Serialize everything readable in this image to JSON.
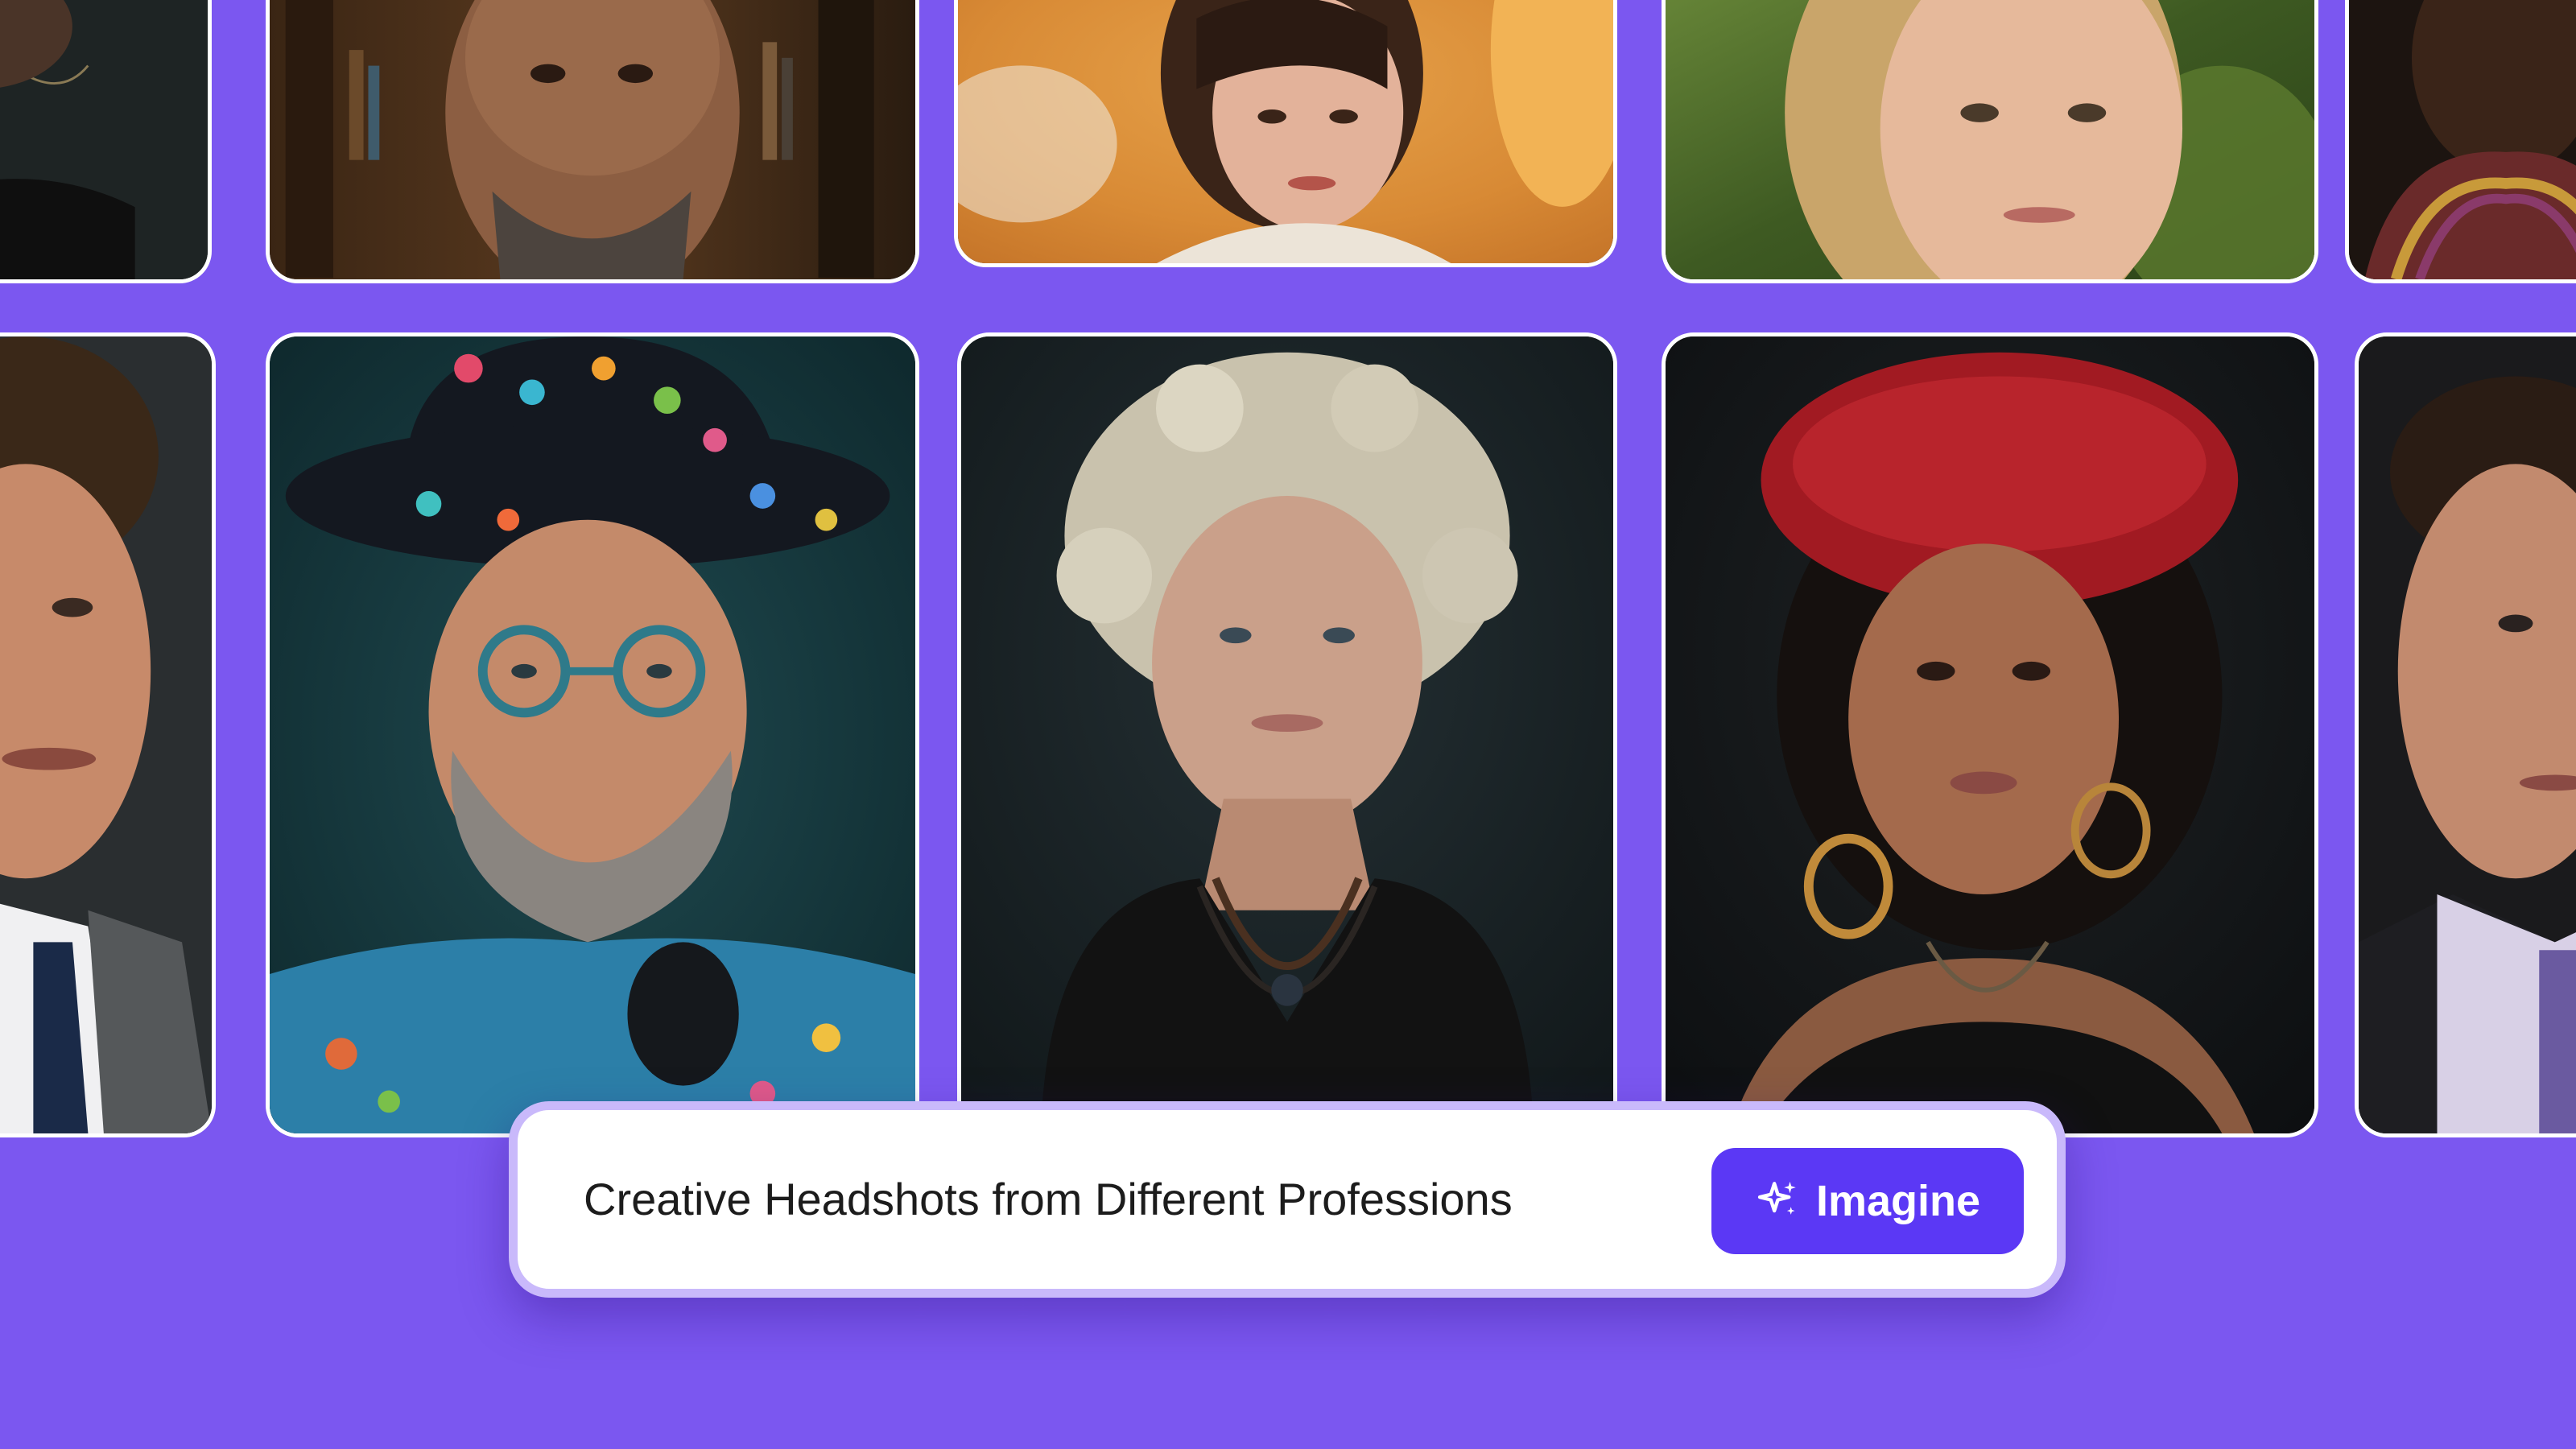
{
  "prompt": {
    "text": "Creative Headshots from Different Professions",
    "button_label": "Imagine",
    "button_icon": "sparkle-icon"
  },
  "colors": {
    "background": "#7b57f0",
    "button": "#5b38f5",
    "bar_border": "#c9b9fb",
    "card_border": "#ffffff"
  }
}
